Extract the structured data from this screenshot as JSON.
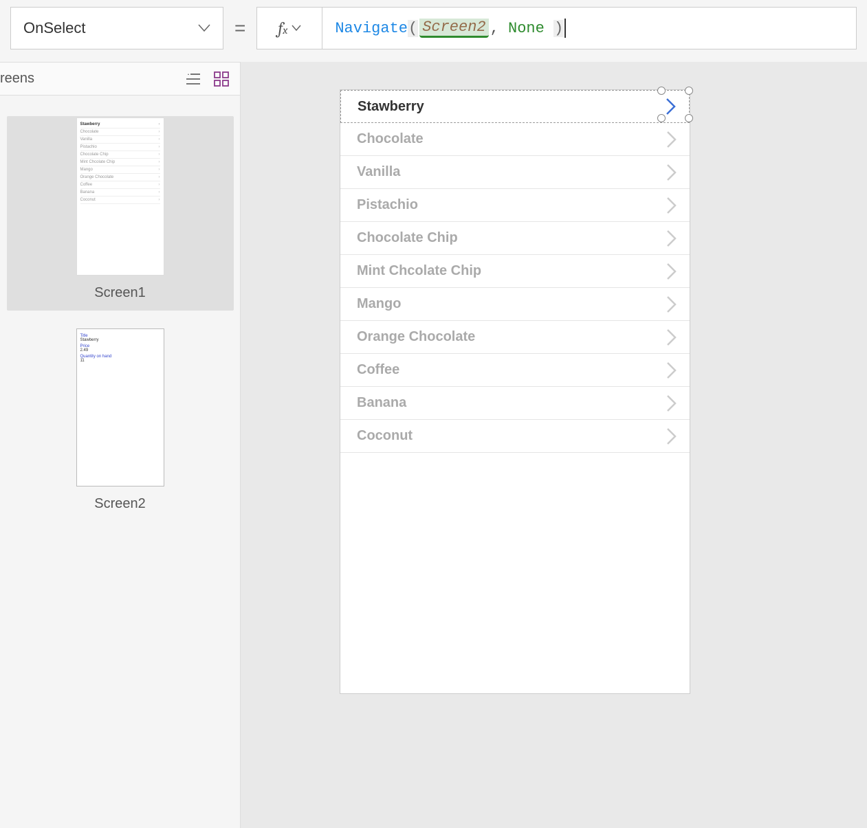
{
  "property_dropdown": {
    "selected": "OnSelect"
  },
  "formula": {
    "function": "Navigate",
    "arg1": "Screen2",
    "arg2": "None"
  },
  "tree": {
    "title": "reens",
    "screens": [
      {
        "name": "Screen1"
      },
      {
        "name": "Screen2"
      }
    ]
  },
  "thumb1_items": [
    "Stawberry",
    "Chocolate",
    "Vanilla",
    "Pistachio",
    "Chocolate Chip",
    "Mint Chcolate Chip",
    "Mango",
    "Orange Chocolate",
    "Coffee",
    "Banana",
    "Coconut"
  ],
  "thumb2": {
    "label1": "Title",
    "val1": "Stawberry",
    "label2": "Price",
    "val2": "2.49",
    "label3": "Quantity on hand",
    "val3": "11"
  },
  "gallery": {
    "items": [
      "Stawberry",
      "Chocolate",
      "Vanilla",
      "Pistachio",
      "Chocolate Chip",
      "Mint Chcolate Chip",
      "Mango",
      "Orange Chocolate",
      "Coffee",
      "Banana",
      "Coconut"
    ]
  }
}
